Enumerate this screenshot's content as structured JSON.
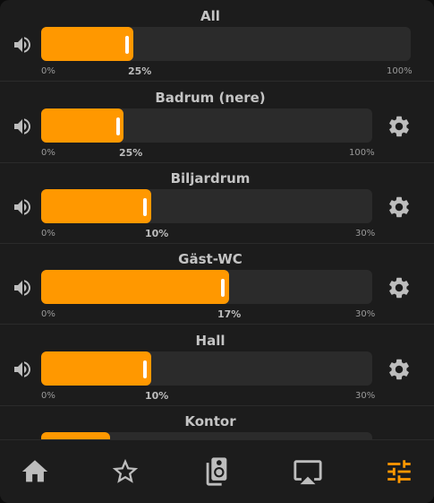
{
  "zones": [
    {
      "name": "All",
      "min": "0%",
      "current": "25%",
      "max": "100%",
      "fraction": 0.25,
      "settings": false
    },
    {
      "name": "Badrum (nere)",
      "min": "0%",
      "current": "25%",
      "max": "100%",
      "fraction": 0.25,
      "settings": true
    },
    {
      "name": "Biljardrum",
      "min": "0%",
      "current": "10%",
      "max": "30%",
      "fraction": 0.333,
      "settings": true
    },
    {
      "name": "Gäst-WC",
      "min": "0%",
      "current": "17%",
      "max": "30%",
      "fraction": 0.567,
      "settings": true
    },
    {
      "name": "Hall",
      "min": "0%",
      "current": "10%",
      "max": "30%",
      "fraction": 0.333,
      "settings": true
    },
    {
      "name": "Kontor",
      "fraction": 0.21,
      "settings": true
    }
  ],
  "nav": {
    "items": [
      "home-icon",
      "favorites-star-icon",
      "speaker-icon",
      "airplay-icon",
      "equalizer-sliders-icon"
    ],
    "active": "equalizer-sliders-icon"
  },
  "colors": {
    "accent": "#ff9800",
    "icon": "#bdbdbd",
    "background": "#1c1c1c",
    "track": "#2b2b2b"
  }
}
